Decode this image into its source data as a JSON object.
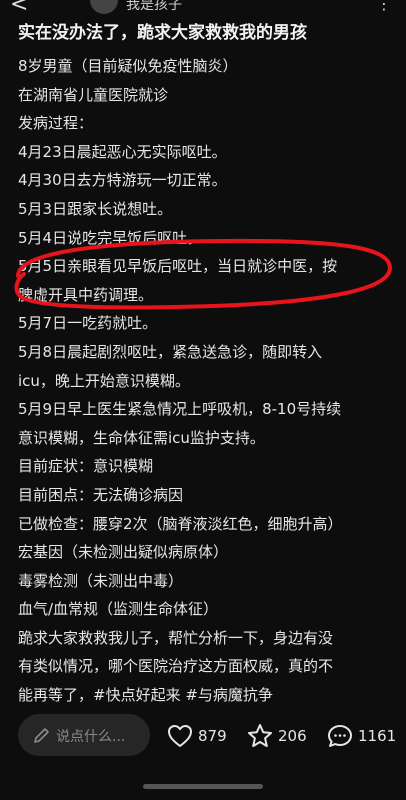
{
  "header": {
    "back_glyph": "<",
    "author": "我是孩子",
    "share_glyph": "⋮"
  },
  "post": {
    "title": "实在没办法了，跪求大家救救我的男孩",
    "lines": [
      "8岁男童（目前疑似免疫性脑炎）",
      "在湖南省儿童医院就诊",
      "发病过程：",
      "4月23日晨起恶心无实际呕吐。",
      "4月30日去方特游玩一切正常。",
      "5月3日跟家长说想吐。",
      "5月4日说吃完早饭后呕吐。",
      "5月5日亲眼看见早饭后呕吐，当日就诊中医，按",
      "脾虚开具中药调理。",
      "5月7日一吃药就吐。",
      "5月8日晨起剧烈呕吐，紧急送急诊，随即转入",
      "icu，晚上开始意识模糊。",
      "5月9日早上医生紧急情况上呼吸机，8-10号持续",
      "意识模糊，生命体征需icu监护支持。",
      "目前症状：意识模糊",
      "目前困点：无法确诊病因",
      "已做检查：腰穿2次（脑脊液淡红色，细胞升高）",
      "宏基因（未检测出疑似病原体）",
      "毒雾检测（未测出中毒）",
      "血气/血常规（监测生命体征）",
      "跪求大家救救我儿子，帮忙分析一下，身边有没",
      "有类似情况，哪个医院治疗这方面权威，真的不",
      "能再等了，#快点好起来 #与病魔抗争"
    ],
    "annotation_color": "#e8141c"
  },
  "footer": {
    "comment_placeholder": "说点什么...",
    "likes": "879",
    "favorites": "206",
    "comments": "1161",
    "icons": [
      "pen-icon",
      "heart-icon",
      "star-icon",
      "comment-bubble-icon"
    ]
  }
}
